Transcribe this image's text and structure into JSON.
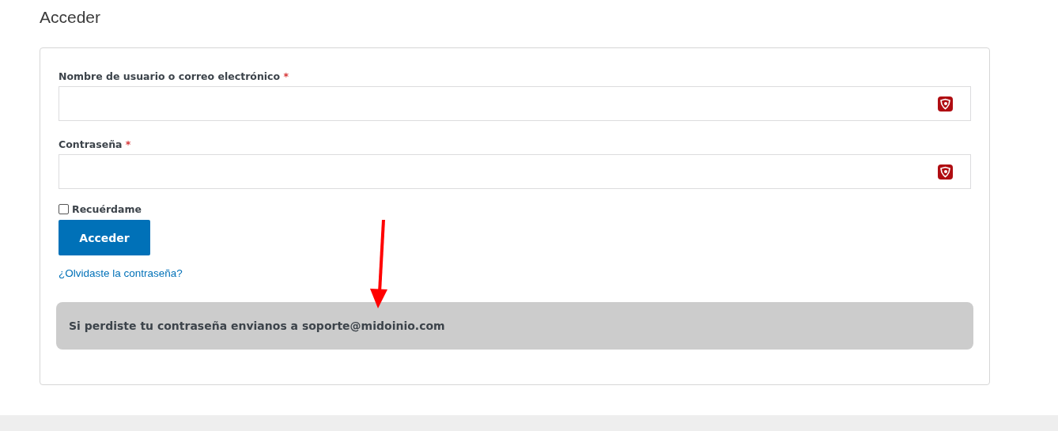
{
  "title": "Acceder",
  "fields": [
    {
      "label": "Nombre de usuario o correo electrónico",
      "required_mark": "*"
    },
    {
      "label": "Contraseña",
      "required_mark": "*"
    }
  ],
  "remember": {
    "label": "Recuérdame",
    "checked": false
  },
  "submit": "Acceder",
  "lost_password": "¿Olvidaste la contraseña?",
  "notice": "Si perdiste tu contraseña envianos a soporte@midoinio.com"
}
